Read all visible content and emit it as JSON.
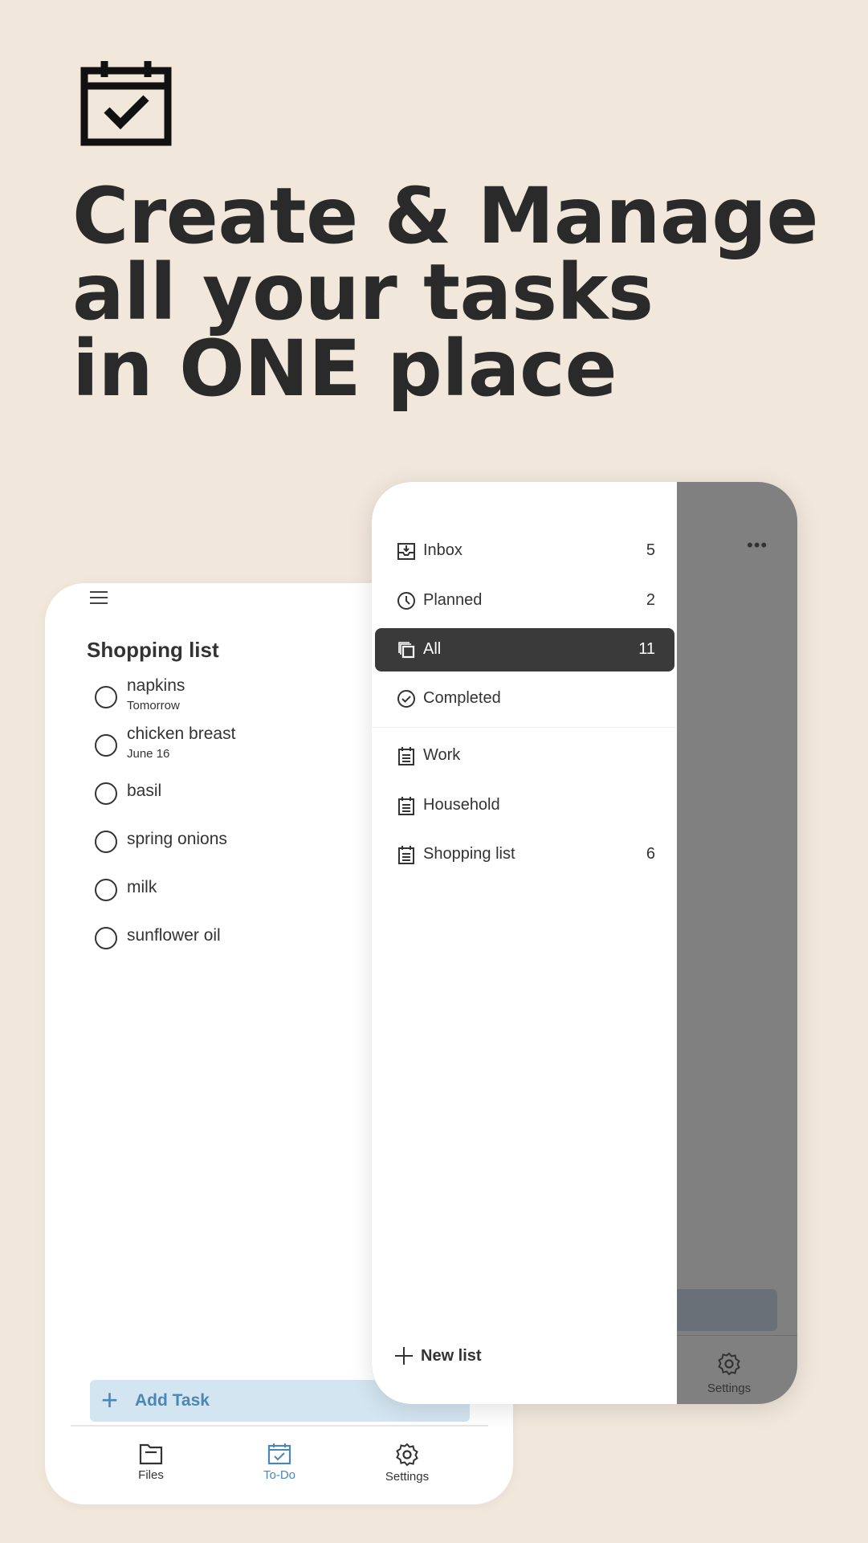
{
  "hero": {
    "icon": "calendar-check-icon",
    "headline": [
      "Create & Manage",
      "all your tasks",
      "in ONE place"
    ]
  },
  "left_screen": {
    "menu_icon": "hamburger-icon",
    "list_title": "Shopping list",
    "tasks": [
      {
        "title": "napkins",
        "due": "Tomorrow"
      },
      {
        "title": "chicken breast",
        "due": "June 16"
      },
      {
        "title": "basil"
      },
      {
        "title": "spring onions"
      },
      {
        "title": "milk"
      },
      {
        "title": "sunflower oil"
      }
    ],
    "add_task_label": "Add Task",
    "nav": [
      {
        "label": "Files",
        "icon": "folder-icon",
        "active": false
      },
      {
        "label": "To-Do",
        "icon": "calendar-check-icon",
        "active": true
      },
      {
        "label": "Settings",
        "icon": "gear-icon",
        "active": false
      }
    ]
  },
  "drawer": {
    "smart_lists": [
      {
        "label": "Inbox",
        "count": "5",
        "icon": "inbox-icon"
      },
      {
        "label": "Planned",
        "count": "2",
        "icon": "clock-icon"
      },
      {
        "label": "All",
        "count": "11",
        "icon": "copy-icon",
        "active": true
      },
      {
        "label": "Completed",
        "count": "",
        "icon": "check-circle-icon"
      }
    ],
    "lists": [
      {
        "label": "Work",
        "count": "",
        "icon": "list-calendar-icon"
      },
      {
        "label": "Household",
        "count": "",
        "icon": "list-calendar-icon"
      },
      {
        "label": "Shopping list",
        "count": "6",
        "icon": "list-calendar-icon"
      }
    ],
    "new_list_label": "New list"
  },
  "background_screen": {
    "more_icon": "more-dots-icon",
    "settings_label": "Settings"
  },
  "colors": {
    "background": "#f1e7db",
    "accent": "#4a86b6",
    "add_task_bg": "#d3e5f1",
    "active_item": "#3a3a3a",
    "scrim": "#808080"
  }
}
